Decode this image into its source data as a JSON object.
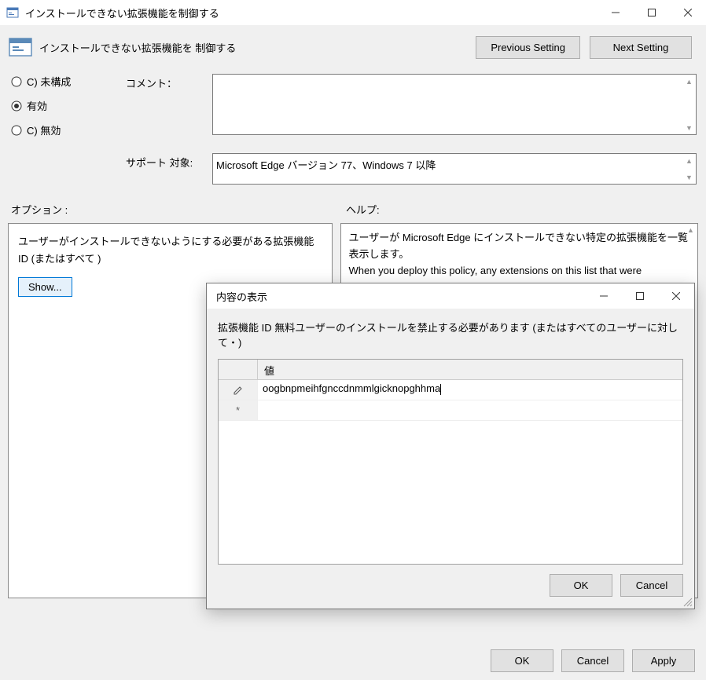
{
  "main": {
    "title": "インストールできない拡張機能を制御する",
    "header_title": "インストールできない拡張機能を 制御する",
    "btn_prev": "Previous Setting",
    "btn_next": "Next Setting",
    "radio": {
      "not_configured": "C) 未構成",
      "enabled": "有効",
      "disabled": "C) 無効"
    },
    "comment_label": "コメント：",
    "support_label": "サポート 対象:",
    "support_value": "Microsoft Edge バージョン 77、Windows 7 以降",
    "options_label": "オプション :",
    "help_label": "ヘルプ:",
    "options_desc": "ユーザーがインストールできないようにする必要がある拡張機能 ID (またはすべて )",
    "show_btn": "Show...",
    "help_text_line1": "ユーザーが Microsoft Edge にインストールできない特定の拡張機能を一覧表示します。",
    "help_text_line2": "When you deploy this policy, any extensions on this list that were",
    "btn_ok": "OK",
    "btn_cancel": "Cancel",
    "btn_apply": "Apply"
  },
  "modal": {
    "title": "内容の表示",
    "desc": "拡張機能 ID 無料ユーザーのインストールを禁止する必要があります (またはすべてのユーザーに対して・)",
    "col_value": "値",
    "row1_value": "oogbnpmeihfgnccdnmmlgicknopghhma",
    "btn_ok": "OK",
    "btn_cancel": "Cancel"
  }
}
